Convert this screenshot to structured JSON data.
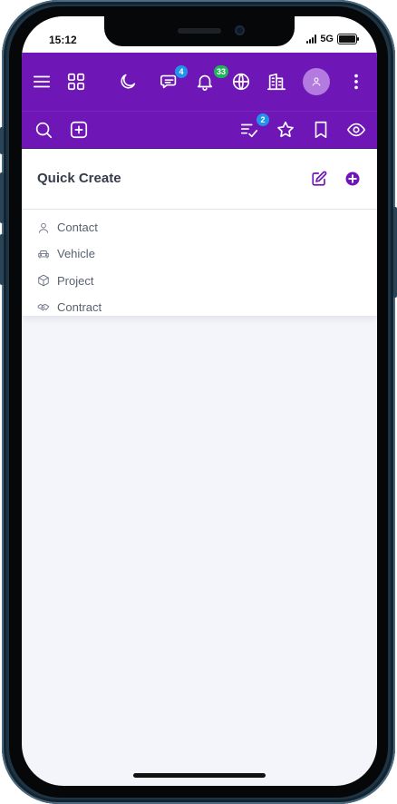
{
  "status_bar": {
    "time": "15:12",
    "network": "5G",
    "battery_level": 1.0
  },
  "topbar": {
    "icons": {
      "menu": "menu-icon",
      "apps": "apps-grid-icon",
      "theme": "moon-icon",
      "messages": "chat-icon",
      "notifications": "bell-icon",
      "language": "globe-icon",
      "company": "building-icon",
      "user": "user-icon",
      "more": "more-vertical-icon"
    },
    "messages_badge": "4",
    "notifications_badge": "33"
  },
  "subbar": {
    "icons": {
      "search": "search-icon",
      "quick_create": "plus-square-icon",
      "tasks": "checklist-icon",
      "favorites": "star-icon",
      "bookmarks": "bookmark-icon",
      "watch": "eye-icon"
    },
    "tasks_badge": "2"
  },
  "quick_create": {
    "title": "Quick Create",
    "items": [
      {
        "label": "Contact",
        "icon": "user-icon"
      },
      {
        "label": "Vehicle",
        "icon": "car-icon"
      },
      {
        "label": "Project",
        "icon": "cube-icon"
      },
      {
        "label": "Contract",
        "icon": "handshake-icon"
      }
    ]
  },
  "colors": {
    "brand": "#6e16b6",
    "badge_blue": "#2094e8",
    "badge_green": "#20b25c",
    "panel_text": "#363c4a",
    "menu_text": "#5a6171",
    "background": "#f4f5fa"
  }
}
